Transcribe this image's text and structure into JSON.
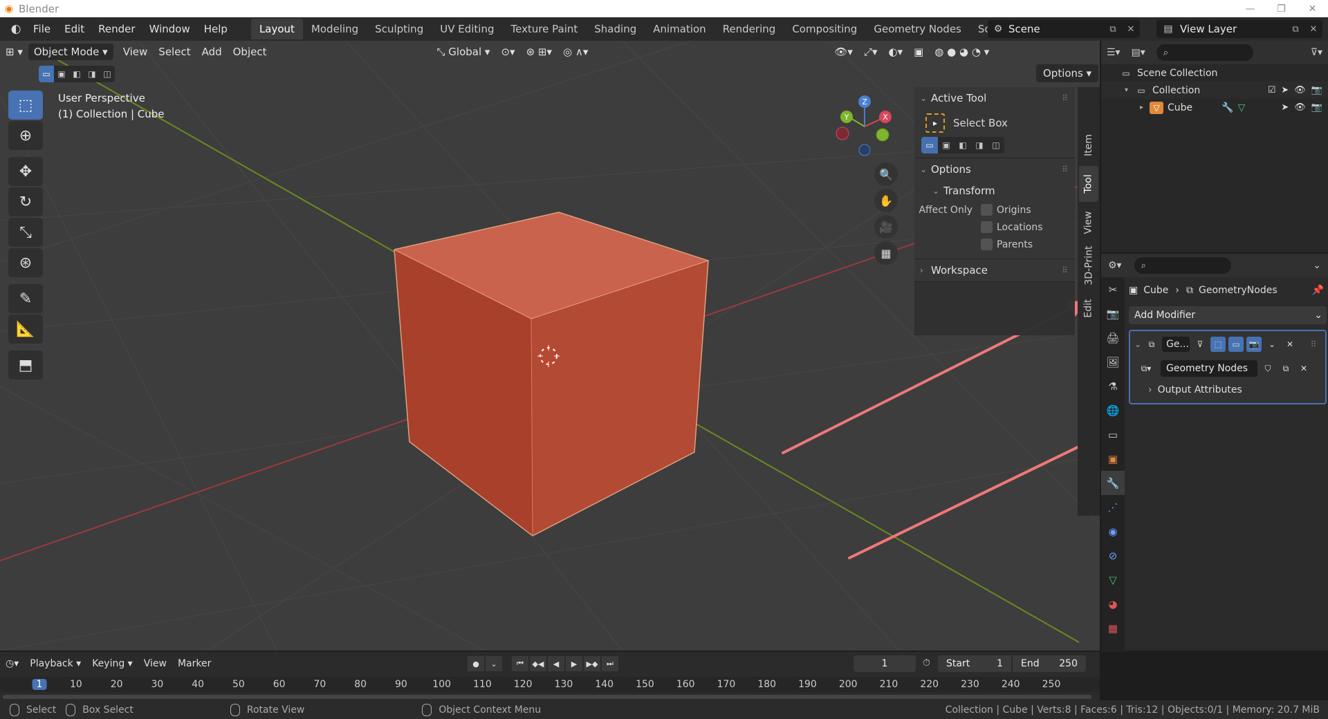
{
  "window": {
    "title": "Blender"
  },
  "menu": {
    "items": [
      "File",
      "Edit",
      "Render",
      "Window",
      "Help"
    ],
    "workspaces": [
      "Layout",
      "Modeling",
      "Sculpting",
      "UV Editing",
      "Texture Paint",
      "Shading",
      "Animation",
      "Rendering",
      "Compositing",
      "Geometry Nodes",
      "Scripting"
    ],
    "active_workspace": "Layout",
    "scene": "Scene",
    "view_layer": "View Layer"
  },
  "viewport": {
    "mode": "Object Mode",
    "menus": [
      "View",
      "Select",
      "Add",
      "Object"
    ],
    "orientation": "Global",
    "options_label": "Options",
    "info_line1": "User Perspective",
    "info_line2": "(1) Collection | Cube",
    "cube_color": "#c0513a"
  },
  "npanel": {
    "active_tool_title": "Active Tool",
    "tool_name": "Select Box",
    "options_title": "Options",
    "transform_title": "Transform",
    "affect_only_label": "Affect Only",
    "checkboxes": [
      "Origins",
      "Locations",
      "Parents"
    ],
    "workspace_title": "Workspace",
    "tabs": [
      "Item",
      "Tool",
      "View",
      "3D-Print",
      "Edit"
    ]
  },
  "outliner": {
    "rows": [
      {
        "label": "Scene Collection"
      },
      {
        "label": "Collection"
      },
      {
        "label": "Cube"
      }
    ]
  },
  "properties": {
    "breadcrumb_object": "Cube",
    "breadcrumb_modifier": "GeometryNodes",
    "add_modifier": "Add Modifier",
    "modifier_name": "Ge...",
    "node_group": "Geometry Nodes",
    "output_attributes": "Output Attributes"
  },
  "timeline": {
    "menus": [
      "Playback",
      "Keying",
      "View",
      "Marker"
    ],
    "current_frame": "1",
    "start_label": "Start",
    "start_value": "1",
    "end_label": "End",
    "end_value": "250",
    "ticks": [
      "1",
      "10",
      "20",
      "30",
      "40",
      "50",
      "60",
      "70",
      "80",
      "90",
      "100",
      "110",
      "120",
      "130",
      "140",
      "150",
      "160",
      "170",
      "180",
      "190",
      "200",
      "210",
      "220",
      "230",
      "240",
      "250"
    ]
  },
  "status": {
    "hint_select": "Select",
    "hint_box": "Box Select",
    "hint_rotate": "Rotate View",
    "hint_context": "Object Context Menu",
    "stats": "Collection | Cube | Verts:8 | Faces:6 | Tris:12 | Objects:0/1 | Memory: 20.7 MiB"
  },
  "colors": {
    "accent": "#4772b3",
    "annotation_arrow": "#f07878"
  }
}
